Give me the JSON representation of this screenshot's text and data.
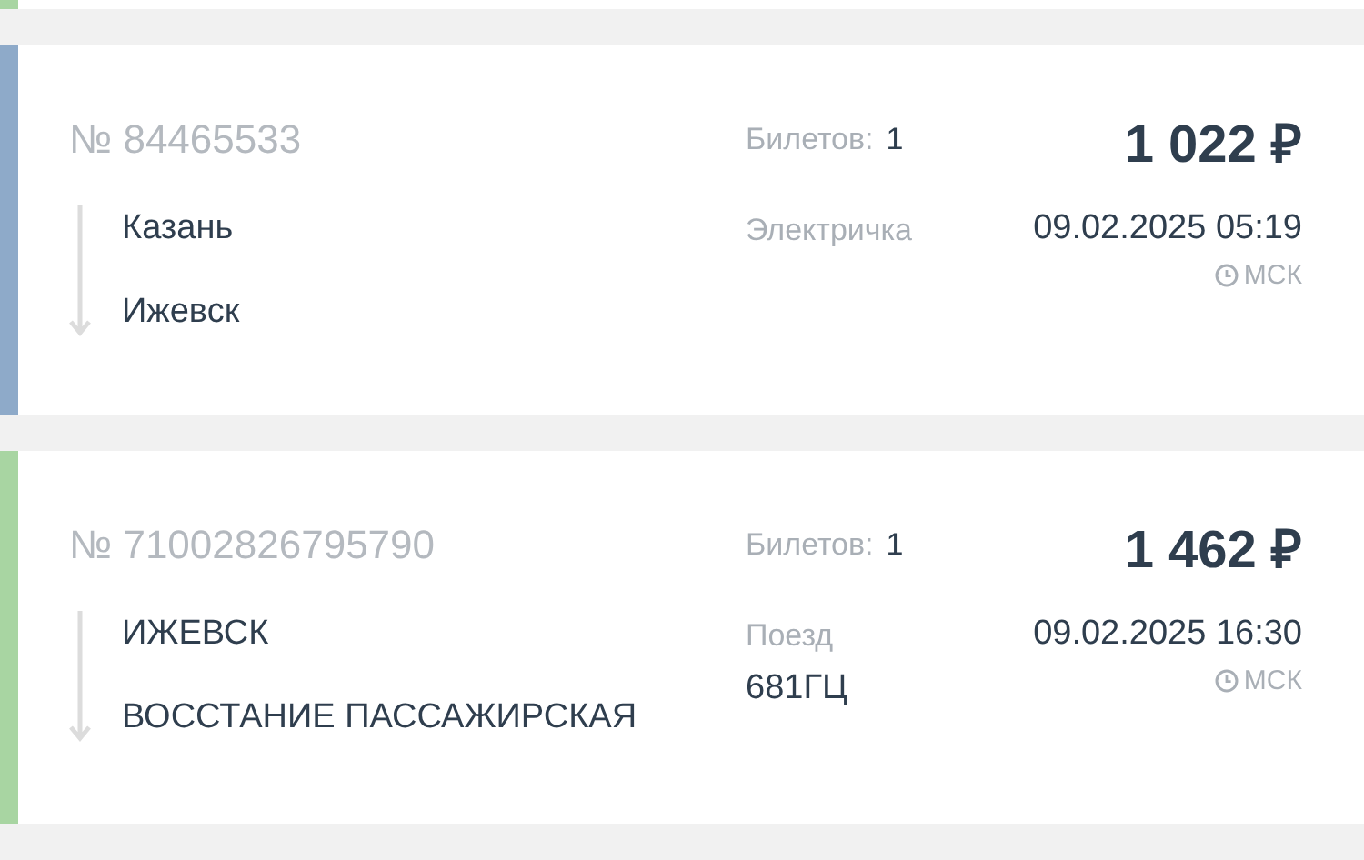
{
  "orders": [
    {
      "color": "#a8d5a2"
    },
    {
      "color": "#8eaac9",
      "number": "№ 84465533",
      "tickets_label": "Билетов:",
      "tickets_count": "1",
      "price": "1 022 ₽",
      "from": "Казань",
      "to": "Ижевск",
      "transport": "Электричка",
      "datetime": "09.02.2025 05:19",
      "timezone": "МСК"
    },
    {
      "color": "#a8d5a2",
      "number": "№ 71002826795790",
      "tickets_label": "Билетов:",
      "tickets_count": "1",
      "price": "1 462 ₽",
      "from": "ИЖЕВСК",
      "to": "ВОССТАНИЕ ПАССАЖИРСКАЯ",
      "transport": "Поезд",
      "train_number": "681ГЦ",
      "datetime": "09.02.2025 16:30",
      "timezone": "МСК"
    }
  ]
}
